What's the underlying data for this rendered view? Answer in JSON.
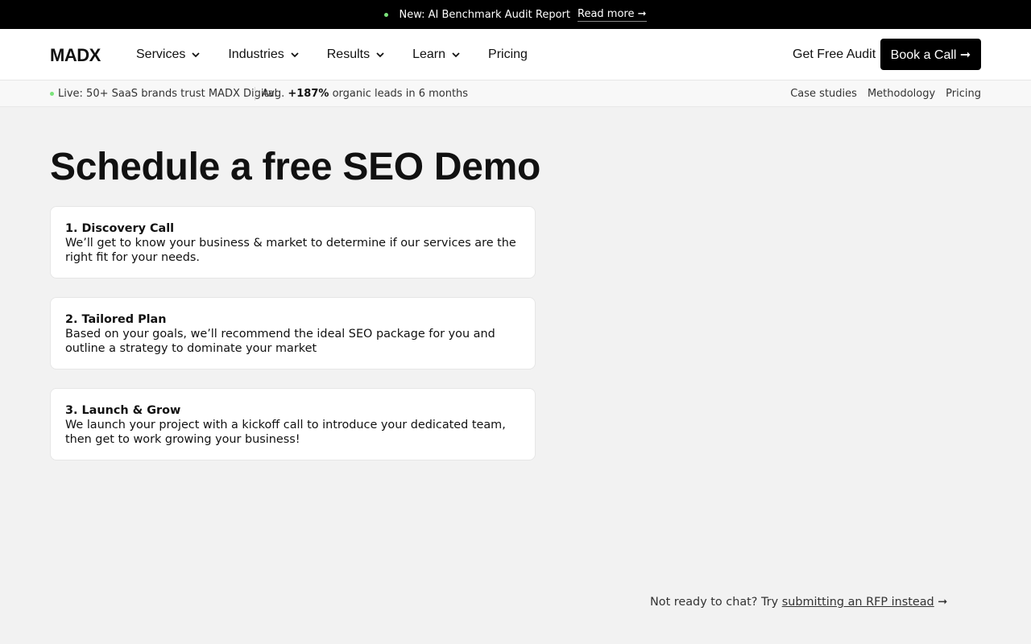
{
  "announcement": {
    "text": "New: AI Benchmark Audit Report",
    "link": "Read more ➞"
  },
  "header": {
    "logo": "MADX",
    "nav": [
      {
        "label": "Services",
        "has_dropdown": true
      },
      {
        "label": "Industries",
        "has_dropdown": true
      },
      {
        "label": "Results",
        "has_dropdown": true
      },
      {
        "label": "Learn",
        "has_dropdown": true
      },
      {
        "label": "Pricing",
        "has_dropdown": false
      }
    ],
    "audit_link": "Get Free Audit",
    "cta": "Book a Call ➞"
  },
  "subbar": {
    "live_text": "Live: 50+ SaaS brands trust MADX Digital",
    "avg_prefix": "Avg.",
    "avg_value": "+187%",
    "avg_suffix": "organic leads in 6 months",
    "links": [
      "Case studies",
      "Methodology",
      "Pricing"
    ]
  },
  "main": {
    "title": "Schedule a free SEO Demo",
    "steps": [
      {
        "title": "1. Discovery Call",
        "text": "We’ll get to know your business & market to determine if our services are the right fit for your needs."
      },
      {
        "title": "2. Tailored Plan",
        "text": "Based on your goals, we’ll recommend the ideal SEO package for you and outline a strategy to dominate your market"
      },
      {
        "title": "3. Launch & Grow",
        "text": "We launch your project with a kickoff call to introduce your dedicated team, then get to work growing your business!"
      }
    ],
    "rfp_prefix": "Not ready to chat? Try",
    "rfp_link": "submitting an RFP instead",
    "rfp_arrow": "➞"
  },
  "colors": {
    "accent_dot": "#7be37b",
    "cta_bg": "#000000",
    "page_bg": "#f2f2f2"
  }
}
